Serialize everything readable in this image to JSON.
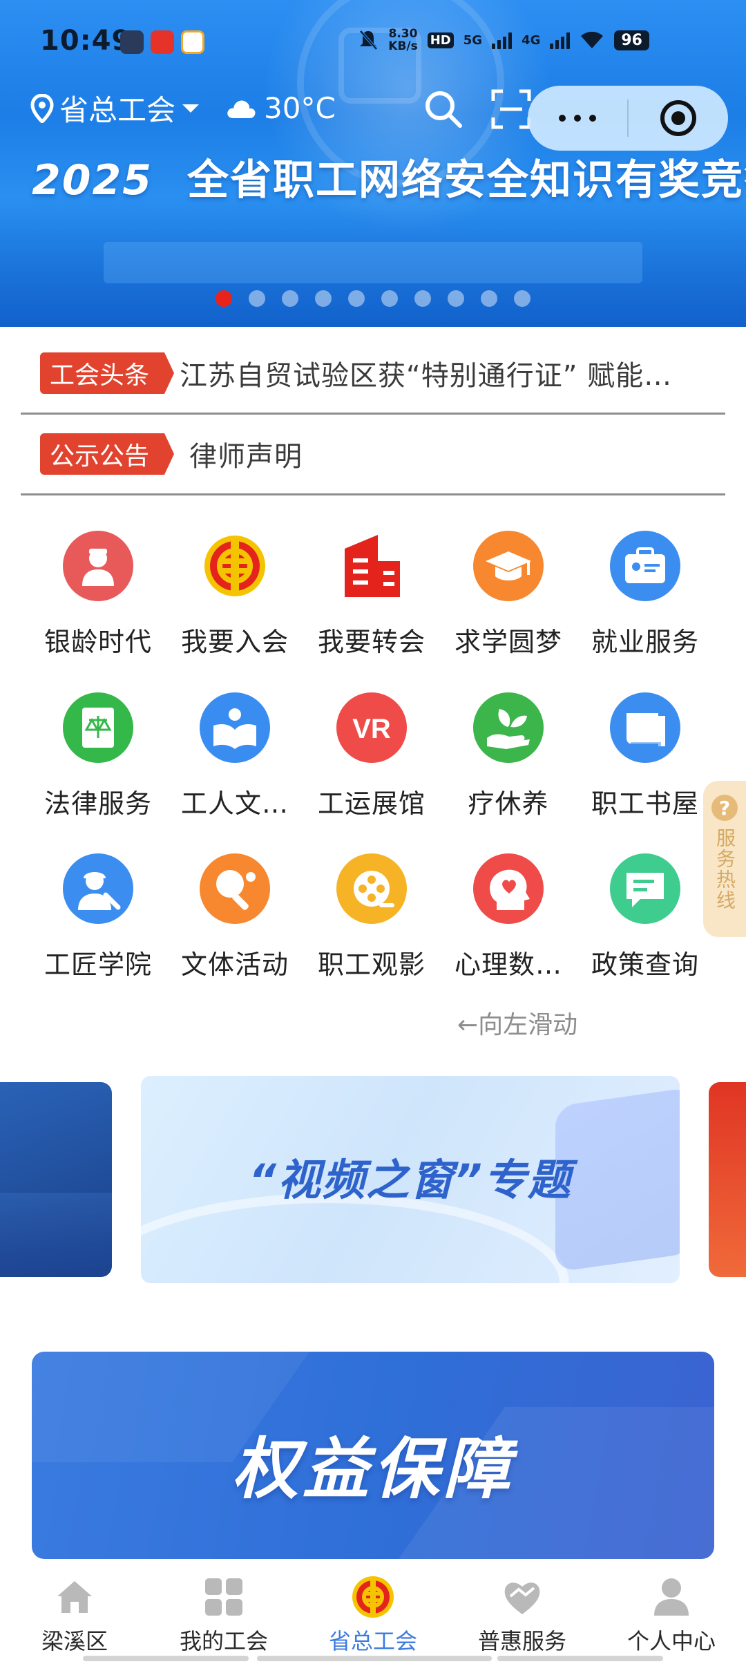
{
  "status_bar": {
    "time": "10:49",
    "net_speed_value": "8.30",
    "net_speed_unit": "KB/s",
    "hd_label": "HD",
    "sig1_label": "5G",
    "sig2_label": "4G",
    "battery": "96"
  },
  "header": {
    "location": "省总工会",
    "temperature": "30°C"
  },
  "hero": {
    "year": "2025",
    "title": "全省职工网络安全知识有奖竞答",
    "dots_total": 10,
    "dots_active": 0
  },
  "news": [
    {
      "tag": "工会头条",
      "text": "江苏自贸试验区获“特别通行证” 赋能…"
    },
    {
      "tag": "公示公告",
      "text": "律师声明"
    }
  ],
  "services": [
    {
      "label": "银龄时代",
      "icon": "elder-icon",
      "color": "#e8595a"
    },
    {
      "label": "我要入会",
      "icon": "union-emblem-icon",
      "color": "#e3231c"
    },
    {
      "label": "我要转会",
      "icon": "building-icon",
      "color": "#e3231c"
    },
    {
      "label": "求学圆梦",
      "icon": "graduation-cap-icon",
      "color": "#f7882f"
    },
    {
      "label": "就业服务",
      "icon": "briefcase-icon",
      "color": "#3b8ef0"
    },
    {
      "label": "法律服务",
      "icon": "law-book-icon",
      "color": "#34b84a"
    },
    {
      "label": "工人文…",
      "icon": "open-book-icon",
      "color": "#3a8df0"
    },
    {
      "label": "工运展馆",
      "icon": "vr-icon",
      "color": "#ef4b48"
    },
    {
      "label": "疗休养",
      "icon": "leaf-hand-icon",
      "color": "#3cb54a"
    },
    {
      "label": "职工书屋",
      "icon": "book-icon",
      "color": "#3b8ef0"
    },
    {
      "label": "工匠学院",
      "icon": "craftsman-icon",
      "color": "#3b8ef0"
    },
    {
      "label": "文体活动",
      "icon": "ping-pong-icon",
      "color": "#f7882f"
    },
    {
      "label": "职工观影",
      "icon": "film-reel-icon",
      "color": "#f5b325"
    },
    {
      "label": "心理数…",
      "icon": "heart-head-icon",
      "color": "#ef4b48"
    },
    {
      "label": "政策查询",
      "icon": "chat-bubble-icon",
      "color": "#3fcc8f"
    }
  ],
  "swipe_hint": "←向左滑动",
  "hotline": {
    "label": "服务热线"
  },
  "video_card": {
    "title": "“视频之窗”专题"
  },
  "rights_banner": {
    "title": "权益保障"
  },
  "bottom_nav": [
    {
      "label": "梁溪区",
      "icon": "home-icon",
      "active": false
    },
    {
      "label": "我的工会",
      "icon": "grid-icon",
      "active": false
    },
    {
      "label": "省总工会",
      "icon": "union-emblem-icon",
      "active": true
    },
    {
      "label": "普惠服务",
      "icon": "heart-icon",
      "active": false
    },
    {
      "label": "个人中心",
      "icon": "person-icon",
      "active": false
    }
  ],
  "colors": {
    "accent": "#3d7be0",
    "tag_red": "#e2432e",
    "hero_blue": "#1c7ee6"
  }
}
